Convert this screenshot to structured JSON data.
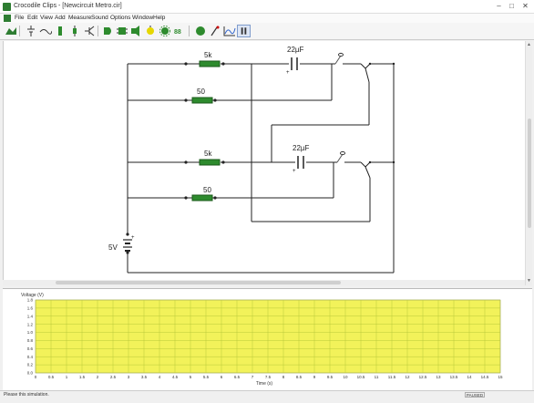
{
  "window": {
    "title": "Crocodile Clips - [Newcircuit Metro.cir]",
    "minimize": "–",
    "maximize": "□",
    "close": "✕"
  },
  "menu": {
    "items": [
      "File",
      "Edit",
      "View",
      "Add",
      "Measure",
      "Sound",
      "Options",
      "Window",
      "Help"
    ]
  },
  "toolbar": {
    "buttons": [
      "component-bin",
      "battery",
      "wire",
      "switch",
      "resistor",
      "transistor",
      "chip-a",
      "chip-b",
      "chip-c",
      "output",
      "led",
      "gear",
      "display",
      "circle",
      "probe",
      "graph",
      "pause"
    ]
  },
  "circuit": {
    "resistors": [
      {
        "label": "5k"
      },
      {
        "label": "50"
      },
      {
        "label": "5k"
      },
      {
        "label": "50"
      }
    ],
    "capacitors": [
      {
        "label": "22µF",
        "polarity": "+"
      },
      {
        "label": "22µF",
        "polarity": "+"
      }
    ],
    "battery": {
      "label": "5V",
      "polarity": "+"
    },
    "colors": {
      "wire": "#222222",
      "resistor": "#2e8b2e",
      "resistor_border": "#1a5a1a"
    }
  },
  "graph": {
    "ylabel": "Voltage (V)",
    "xlabel": "Time (s)",
    "y_ticks": [
      "1.8",
      "1.6",
      "1.4",
      "1.2",
      "1.0",
      "0.8",
      "0.6",
      "0.4",
      "0.2",
      "0.0"
    ],
    "x_ticks": [
      "0",
      "0.5",
      "1",
      "1.5",
      "2",
      "2.5",
      "3",
      "3.5",
      "4",
      "4.5",
      "5",
      "5.5",
      "6",
      "6.5",
      "7",
      "7.5",
      "8",
      "8.5",
      "9",
      "9.5",
      "10",
      "10.5",
      "11",
      "11.5",
      "12",
      "12.5",
      "13",
      "13.5",
      "14",
      "14.5",
      "15"
    ],
    "colors": {
      "plot_bg": "#f2f25a",
      "grid": "#b9c93a",
      "border": "#888888"
    }
  },
  "status": {
    "text": "Please this simulation.",
    "right": "PAUSED"
  }
}
